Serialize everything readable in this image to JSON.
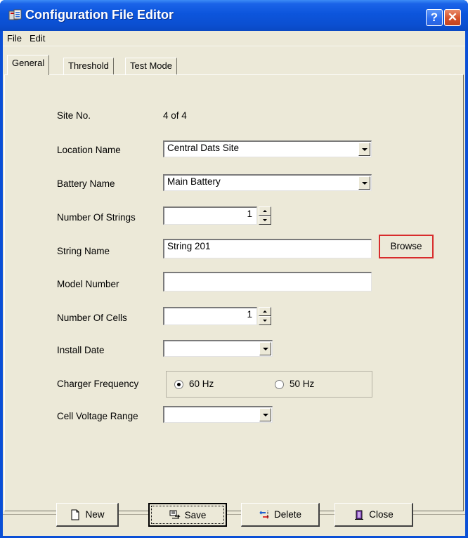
{
  "window": {
    "title": "Configuration File Editor",
    "help_glyph": "?",
    "close_glyph": "✕"
  },
  "menu": [
    "File",
    "Edit"
  ],
  "tabs": [
    {
      "label": "General",
      "active": true
    },
    {
      "label": "Threshold",
      "active": false
    },
    {
      "label": "Test Mode",
      "active": false
    }
  ],
  "form": {
    "site_no_label": "Site No.",
    "site_no_value": "4 of 4",
    "location_name_label": "Location Name",
    "location_name_value": "Central Dats Site",
    "battery_name_label": "Battery Name",
    "battery_name_value": "Main Battery",
    "number_of_strings_label": "Number Of Strings",
    "number_of_strings_value": "1",
    "string_name_label": "String Name",
    "string_name_value": "String 201",
    "browse_label": "Browse",
    "model_number_label": "Model Number",
    "model_number_value": "",
    "number_of_cells_label": "Number Of Cells",
    "number_of_cells_value": "1",
    "install_date_label": "Install Date",
    "install_date_value": "",
    "charger_frequency_label": "Charger Frequency",
    "freq_60_label": "60 Hz",
    "freq_50_label": "50 Hz",
    "freq_selected": "60 Hz",
    "cell_voltage_range_label": "Cell Voltage Range",
    "cell_voltage_range_value": ""
  },
  "buttons": {
    "new": "New",
    "save": "Save",
    "delete": "Delete",
    "close": "Close"
  },
  "colors": {
    "titlebar": "#0b4fd1",
    "dialog_bg": "#ece9d8",
    "browse_highlight": "#d82c2c"
  }
}
